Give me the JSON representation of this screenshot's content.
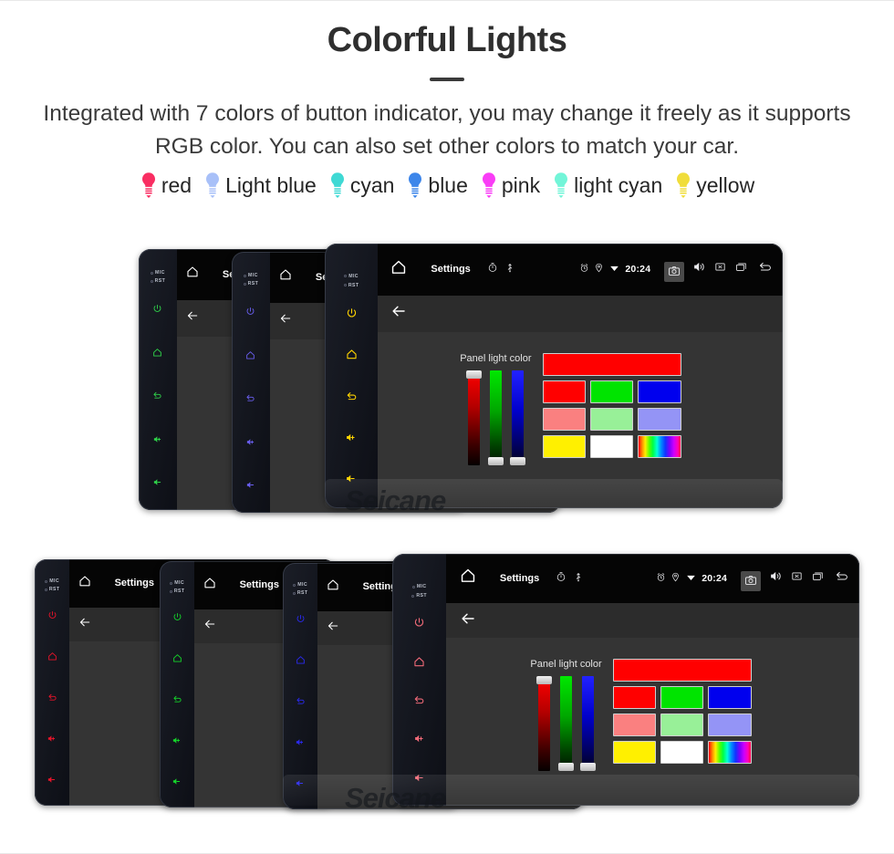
{
  "header": {
    "title": "Colorful Lights",
    "subtitle": "Integrated with 7 colors of button indicator, you may change it freely as it supports RGB color. You can also set other colors to match your car."
  },
  "legend": {
    "items": [
      {
        "label": "red",
        "color": "#f92e62",
        "icon": "bulb-icon"
      },
      {
        "label": "Light blue",
        "color": "#a8c0f8",
        "icon": "bulb-icon"
      },
      {
        "label": "cyan",
        "color": "#3fd9d4",
        "icon": "bulb-icon"
      },
      {
        "label": "blue",
        "color": "#3d86ea",
        "icon": "bulb-icon"
      },
      {
        "label": "pink",
        "color": "#f93df6",
        "icon": "bulb-icon"
      },
      {
        "label": "light cyan",
        "color": "#72f5d8",
        "icon": "bulb-icon"
      },
      {
        "label": "yellow",
        "color": "#f0dd3a",
        "icon": "bulb-icon"
      }
    ]
  },
  "statusbar": {
    "title": "Settings",
    "time": "20:24",
    "left_icons": [
      "home-icon"
    ],
    "small_icons": [
      "timer-icon",
      "usb-icon"
    ],
    "tray_icons": [
      "alarm-icon",
      "location-icon",
      "wifi-icon"
    ],
    "right_icons": [
      "camera-icon",
      "volume-icon",
      "close-icon",
      "recents-icon",
      "back-icon"
    ]
  },
  "actionbar": {
    "icon": "back-arrow-icon"
  },
  "side_panel": {
    "mic_label": "MIC",
    "rst_label": "RST",
    "icons": [
      "power-icon",
      "home-outline-icon",
      "back-curve-icon",
      "volume-up-icon",
      "volume-down-icon"
    ]
  },
  "picker": {
    "label": "Panel light color",
    "sliders": [
      {
        "name": "red-slider",
        "channel": "R",
        "knob_position": "top"
      },
      {
        "name": "green-slider",
        "channel": "G",
        "knob_position": "bottom"
      },
      {
        "name": "blue-slider",
        "channel": "B",
        "knob_position": "bottom"
      }
    ],
    "preview_color": "#ff0000",
    "swatch_rows": [
      [
        "#ff0000",
        "#00e400",
        "#0000ee"
      ],
      [
        "#fa8080",
        "#98f098",
        "#9494f6"
      ],
      [
        "#fff000",
        "#ffffff",
        "rainbow"
      ]
    ]
  },
  "watermark": {
    "text": "Seicane"
  },
  "groups": {
    "top": {
      "name": "top-device-stack",
      "devices": [
        {
          "name": "device-green",
          "accent": "#2fd44a",
          "front": false
        },
        {
          "name": "device-purple",
          "accent": "#6a5ff0",
          "front": false
        },
        {
          "name": "device-yellow",
          "accent": "#ffd400",
          "front": true
        }
      ]
    },
    "bottom": {
      "name": "bottom-device-stack",
      "devices": [
        {
          "name": "device-red",
          "accent": "#e8142a",
          "front": false
        },
        {
          "name": "device-green",
          "accent": "#14d62a",
          "front": false
        },
        {
          "name": "device-blue",
          "accent": "#2a2af0",
          "front": false
        },
        {
          "name": "device-pink",
          "accent": "#f06a78",
          "front": true
        }
      ]
    }
  }
}
